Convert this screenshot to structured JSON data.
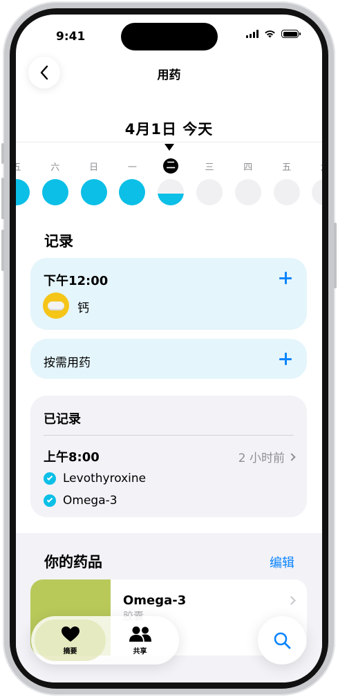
{
  "status_bar": {
    "time": "9:41"
  },
  "nav": {
    "title": "用药"
  },
  "date_header": {
    "title": "4月1日 今天"
  },
  "week": {
    "days": [
      "五",
      "六",
      "日",
      "一",
      "二",
      "三",
      "四",
      "五",
      "六"
    ],
    "progress": [
      1,
      1,
      1,
      1,
      0.45,
      0,
      0,
      0,
      0
    ],
    "today_index": 4
  },
  "log_section": {
    "title": "记录"
  },
  "scheduled": {
    "time": "下午12:00",
    "medication": "钙",
    "pill_color": "#f5c518"
  },
  "as_needed": {
    "label": "按需用药"
  },
  "logged": {
    "title": "已记录",
    "time": "上午8:00",
    "ago": "2 小时前",
    "items": [
      "Levothyroxine",
      "Omega-3"
    ]
  },
  "your_meds": {
    "title": "你的药品",
    "edit_label": "编辑",
    "first": {
      "name": "Omega-3",
      "form": "胶囊"
    }
  },
  "tab_bar": {
    "summary_label": "摘要",
    "sharing_label": "共享"
  },
  "colors": {
    "accent": "#0a84ff",
    "progress": "#0bbfe7",
    "card_blue": "#e4f5fb"
  }
}
